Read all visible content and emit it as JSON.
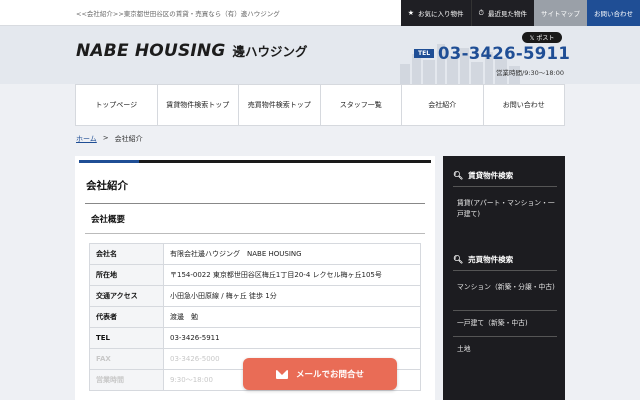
{
  "topbar": {
    "breadcrumb_text": "<<会社紹介>>東京都世田谷区の賃貸・売買なら（有）邊ハウジング",
    "links": [
      {
        "icon": "★",
        "label": "お気に入り物件"
      },
      {
        "icon": "⏱",
        "label": "最近見た物件"
      },
      {
        "icon": "",
        "label": "サイトマップ"
      },
      {
        "icon": "",
        "label": "お問い合わせ"
      }
    ]
  },
  "header": {
    "logo_en": "NABE HOUSING",
    "logo_jp": "邊ハウジング",
    "x_post": "𝕏 ポスト",
    "tel_badge": "TEL",
    "tel_number": "03-3426-5911",
    "hours": "営業時間/9:30～18:00"
  },
  "nav": [
    "トップページ",
    "賃貸物件検索トップ",
    "売買物件検索トップ",
    "スタッフ一覧",
    "会社紹介",
    "お問い合わせ"
  ],
  "breadcrumb": {
    "home": "ホーム",
    "separator": ">",
    "current": "会社紹介"
  },
  "main": {
    "page_title": "会社紹介",
    "section_title": "会社概要",
    "rows": [
      {
        "key": "会社名",
        "value": "有限会社邊ハウジング　NABE HOUSING"
      },
      {
        "key": "所在地",
        "value": "〒154-0022 東京都世田谷区梅丘1丁目20-4 レクセル梅ヶ丘105号"
      },
      {
        "key": "交通アクセス",
        "value": "小田急小田原線 / 梅ヶ丘 徒歩 1分"
      },
      {
        "key": "代表者",
        "value": "渡邊　勉"
      },
      {
        "key": "TEL",
        "value": "03-3426-5911"
      },
      {
        "key": "FAX",
        "value": "03-3426-5000"
      },
      {
        "key": "営業時間",
        "value": "9:30～18:00"
      }
    ]
  },
  "sidebar": {
    "sections": [
      {
        "title": "賃貸物件検索",
        "links": [
          "賃貸(アパート・マンション・一戸建て)"
        ]
      },
      {
        "title": "売買物件検索",
        "links": [
          "マンション（新築・分譲・中古)",
          "一戸建て（新築・中古)",
          "土地"
        ]
      }
    ]
  },
  "mail_button": {
    "label": "メールでお問合せ"
  },
  "colors": {
    "brand_blue": "#1f4e95",
    "mail_button": "#e96c56",
    "sidebar_bg": "#1c1c20"
  }
}
